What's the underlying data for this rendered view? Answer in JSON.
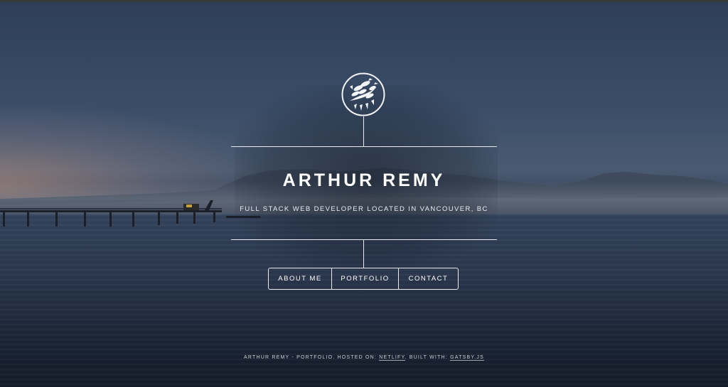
{
  "header": {
    "name": "ARTHUR REMY",
    "tagline": "FULL STACK WEB DEVELOPER LOCATED IN VANCOUVER, BC",
    "logo_icon": "leaf-branch-icon"
  },
  "nav": {
    "items": [
      {
        "label": "ABOUT ME"
      },
      {
        "label": "PORTFOLIO"
      },
      {
        "label": "CONTACT"
      }
    ]
  },
  "footer": {
    "prefix": "ARTHUR REMY - PORTFOLIO. HOSTED ON: ",
    "host_link": "NETLIFY",
    "middle": ". BUILT WITH: ",
    "framework_link": "GATSBY.JS"
  },
  "colors": {
    "line": "#e8ebf0",
    "text": "#ffffff",
    "sky": "#3b4e68",
    "water": "#1c2637"
  }
}
